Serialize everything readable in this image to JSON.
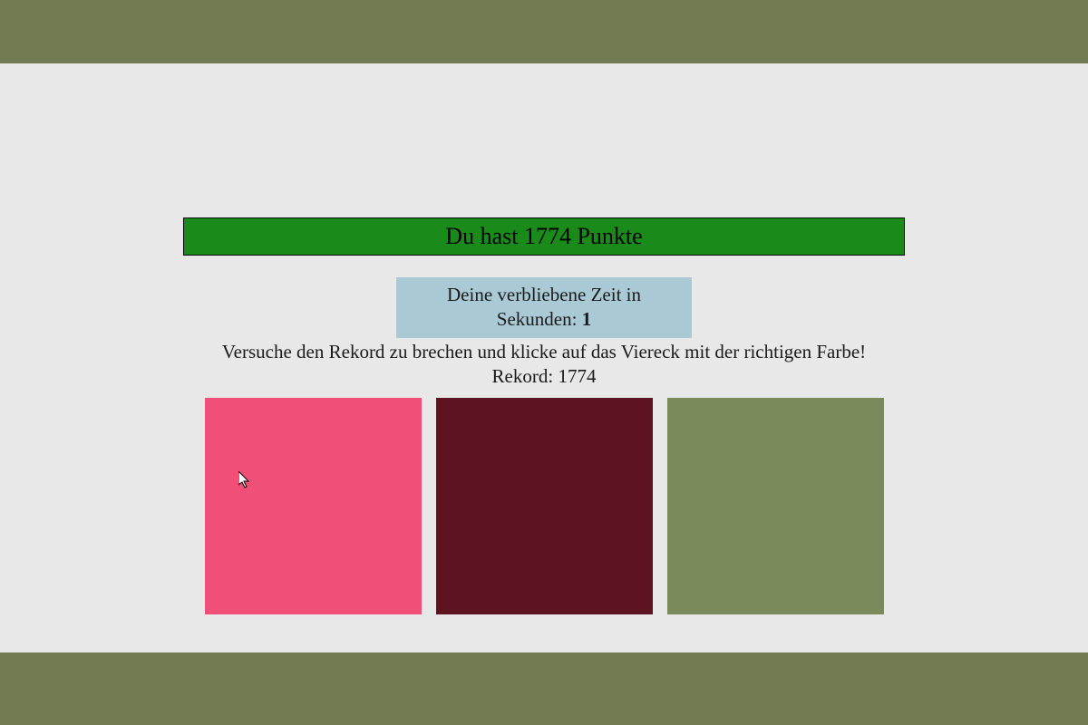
{
  "colors": {
    "banner_bg": "#1a8a1a",
    "timer_bg": "#a9cad5",
    "frame_bar": "#707b52",
    "square1": "#f04f78",
    "square2": "#5e1420",
    "square3": "#7a8a5a"
  },
  "score": {
    "text": "Du hast 1774 Punkte"
  },
  "timer": {
    "line1": "Deine verbliebene Zeit in",
    "line2_prefix": "Sekunden: ",
    "value": "1"
  },
  "instructions": "Versuche den Rekord zu brechen und klicke auf das Viereck mit der richtigen Farbe!",
  "record": {
    "label": "Rekord: ",
    "value": "1774"
  }
}
